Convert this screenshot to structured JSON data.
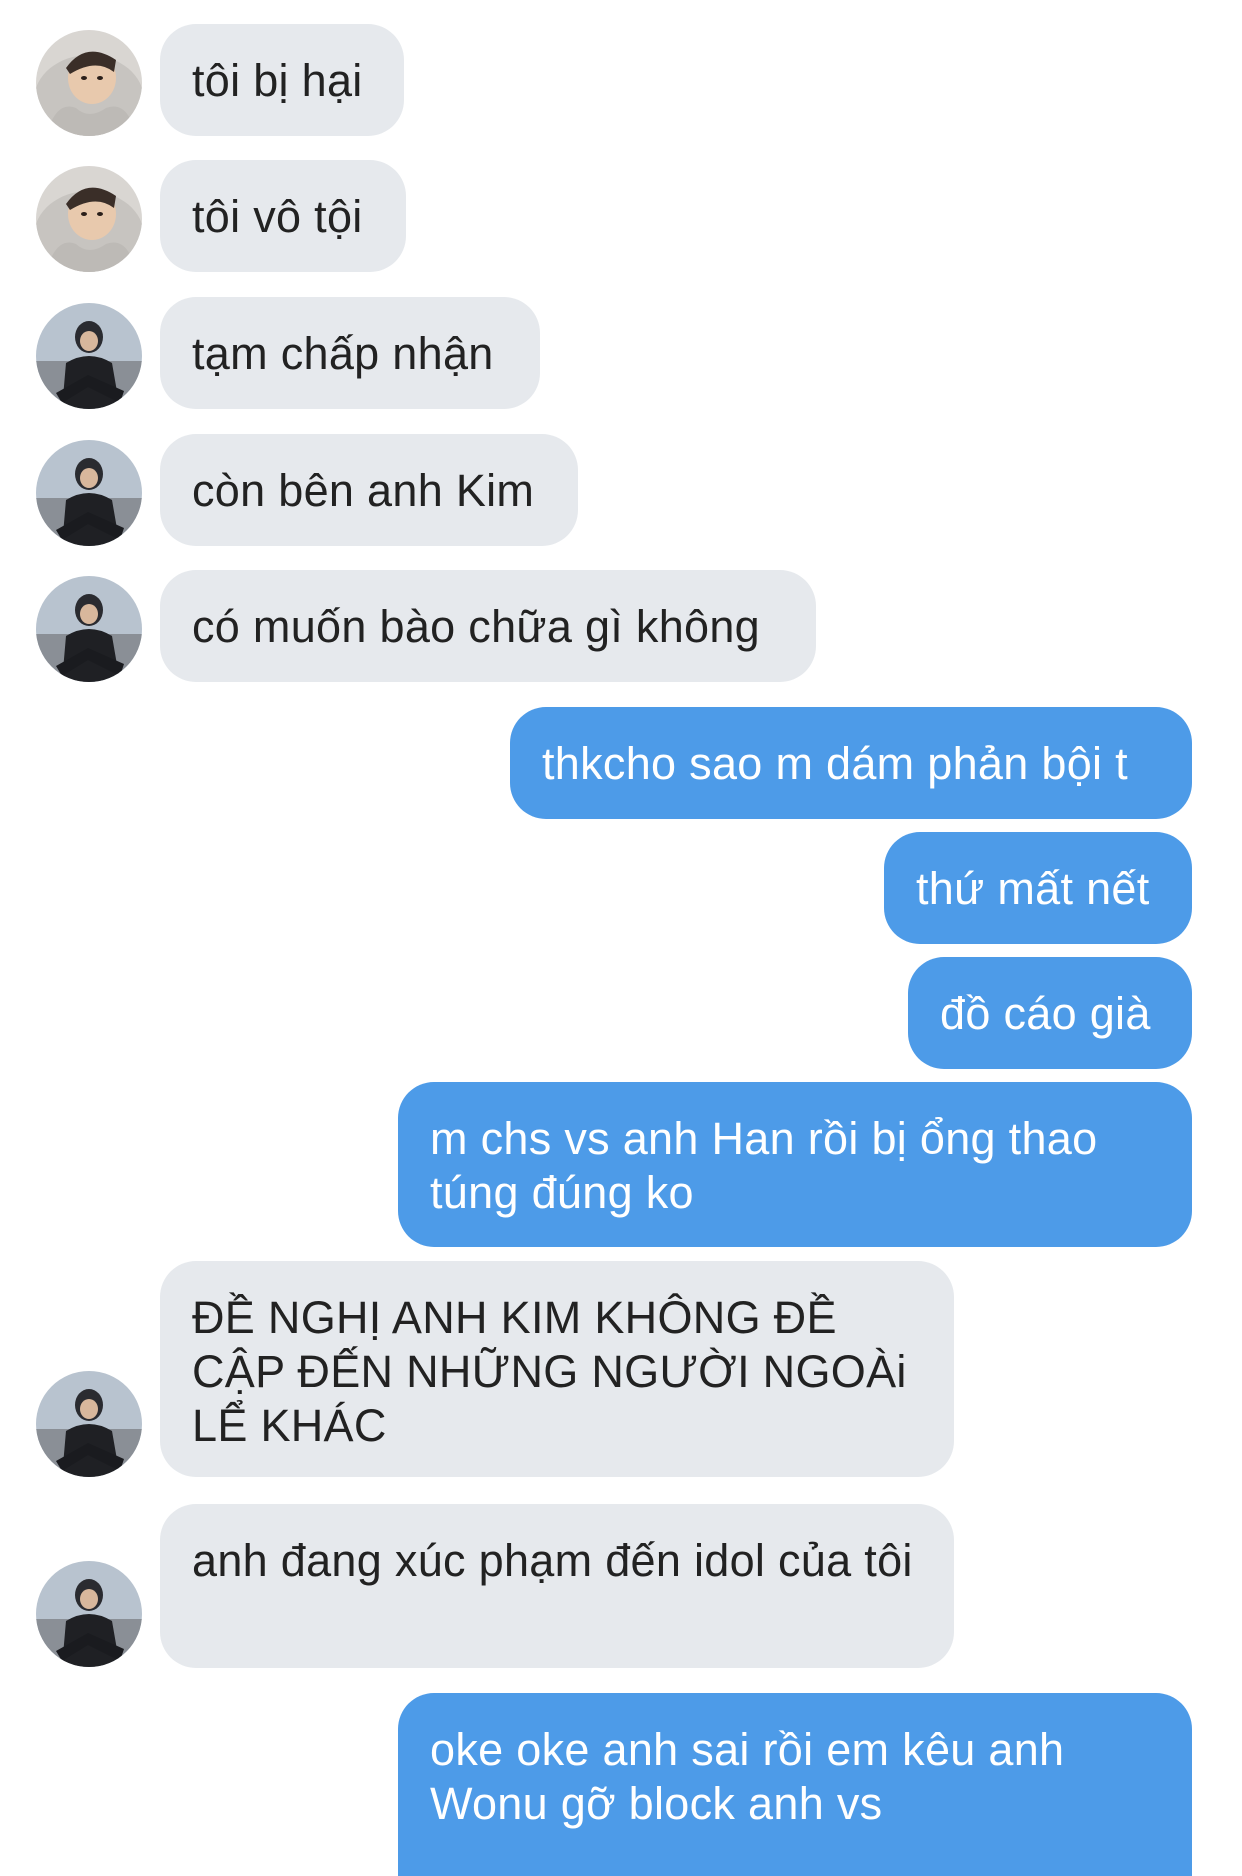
{
  "conversation": {
    "messages": [
      {
        "side": "in",
        "avatar": "avatar-hood",
        "text": "tôi bị hại"
      },
      {
        "side": "in",
        "avatar": "avatar-hood",
        "text": "tôi vô tội"
      },
      {
        "side": "in",
        "avatar": "avatar-dark",
        "text": "tạm chấp nhận"
      },
      {
        "side": "in",
        "avatar": "avatar-dark",
        "text": "còn bên anh Kim"
      },
      {
        "side": "in",
        "avatar": "avatar-dark",
        "text": "có muốn bào chữa gì không"
      },
      {
        "side": "out",
        "text": "thkcho sao m dám phản bội t"
      },
      {
        "side": "out",
        "text": "thứ mất nết"
      },
      {
        "side": "out",
        "text": "đồ cáo già"
      },
      {
        "side": "out",
        "text": "m chs vs anh Han rồi bị ổng thao túng đúng ko"
      },
      {
        "side": "in",
        "avatar": "avatar-dark",
        "text": "ĐỀ NGHỊ ANH KIM KHÔNG ĐỀ CẬP ĐẾN NHỮNG NGƯỜI NGOÀi LỂ KHÁC"
      },
      {
        "side": "in",
        "avatar": "avatar-dark",
        "text": "anh đang xúc phạm đến idol của tôi"
      },
      {
        "side": "out",
        "text": "oke oke anh sai rồi em kêu anh Wonu gỡ block anh vs"
      }
    ]
  },
  "colors": {
    "incoming_bubble": "#e6e9ed",
    "outgoing_bubble": "#4d9be8",
    "outgoing_text": "#ffffff",
    "incoming_text": "#222222"
  }
}
